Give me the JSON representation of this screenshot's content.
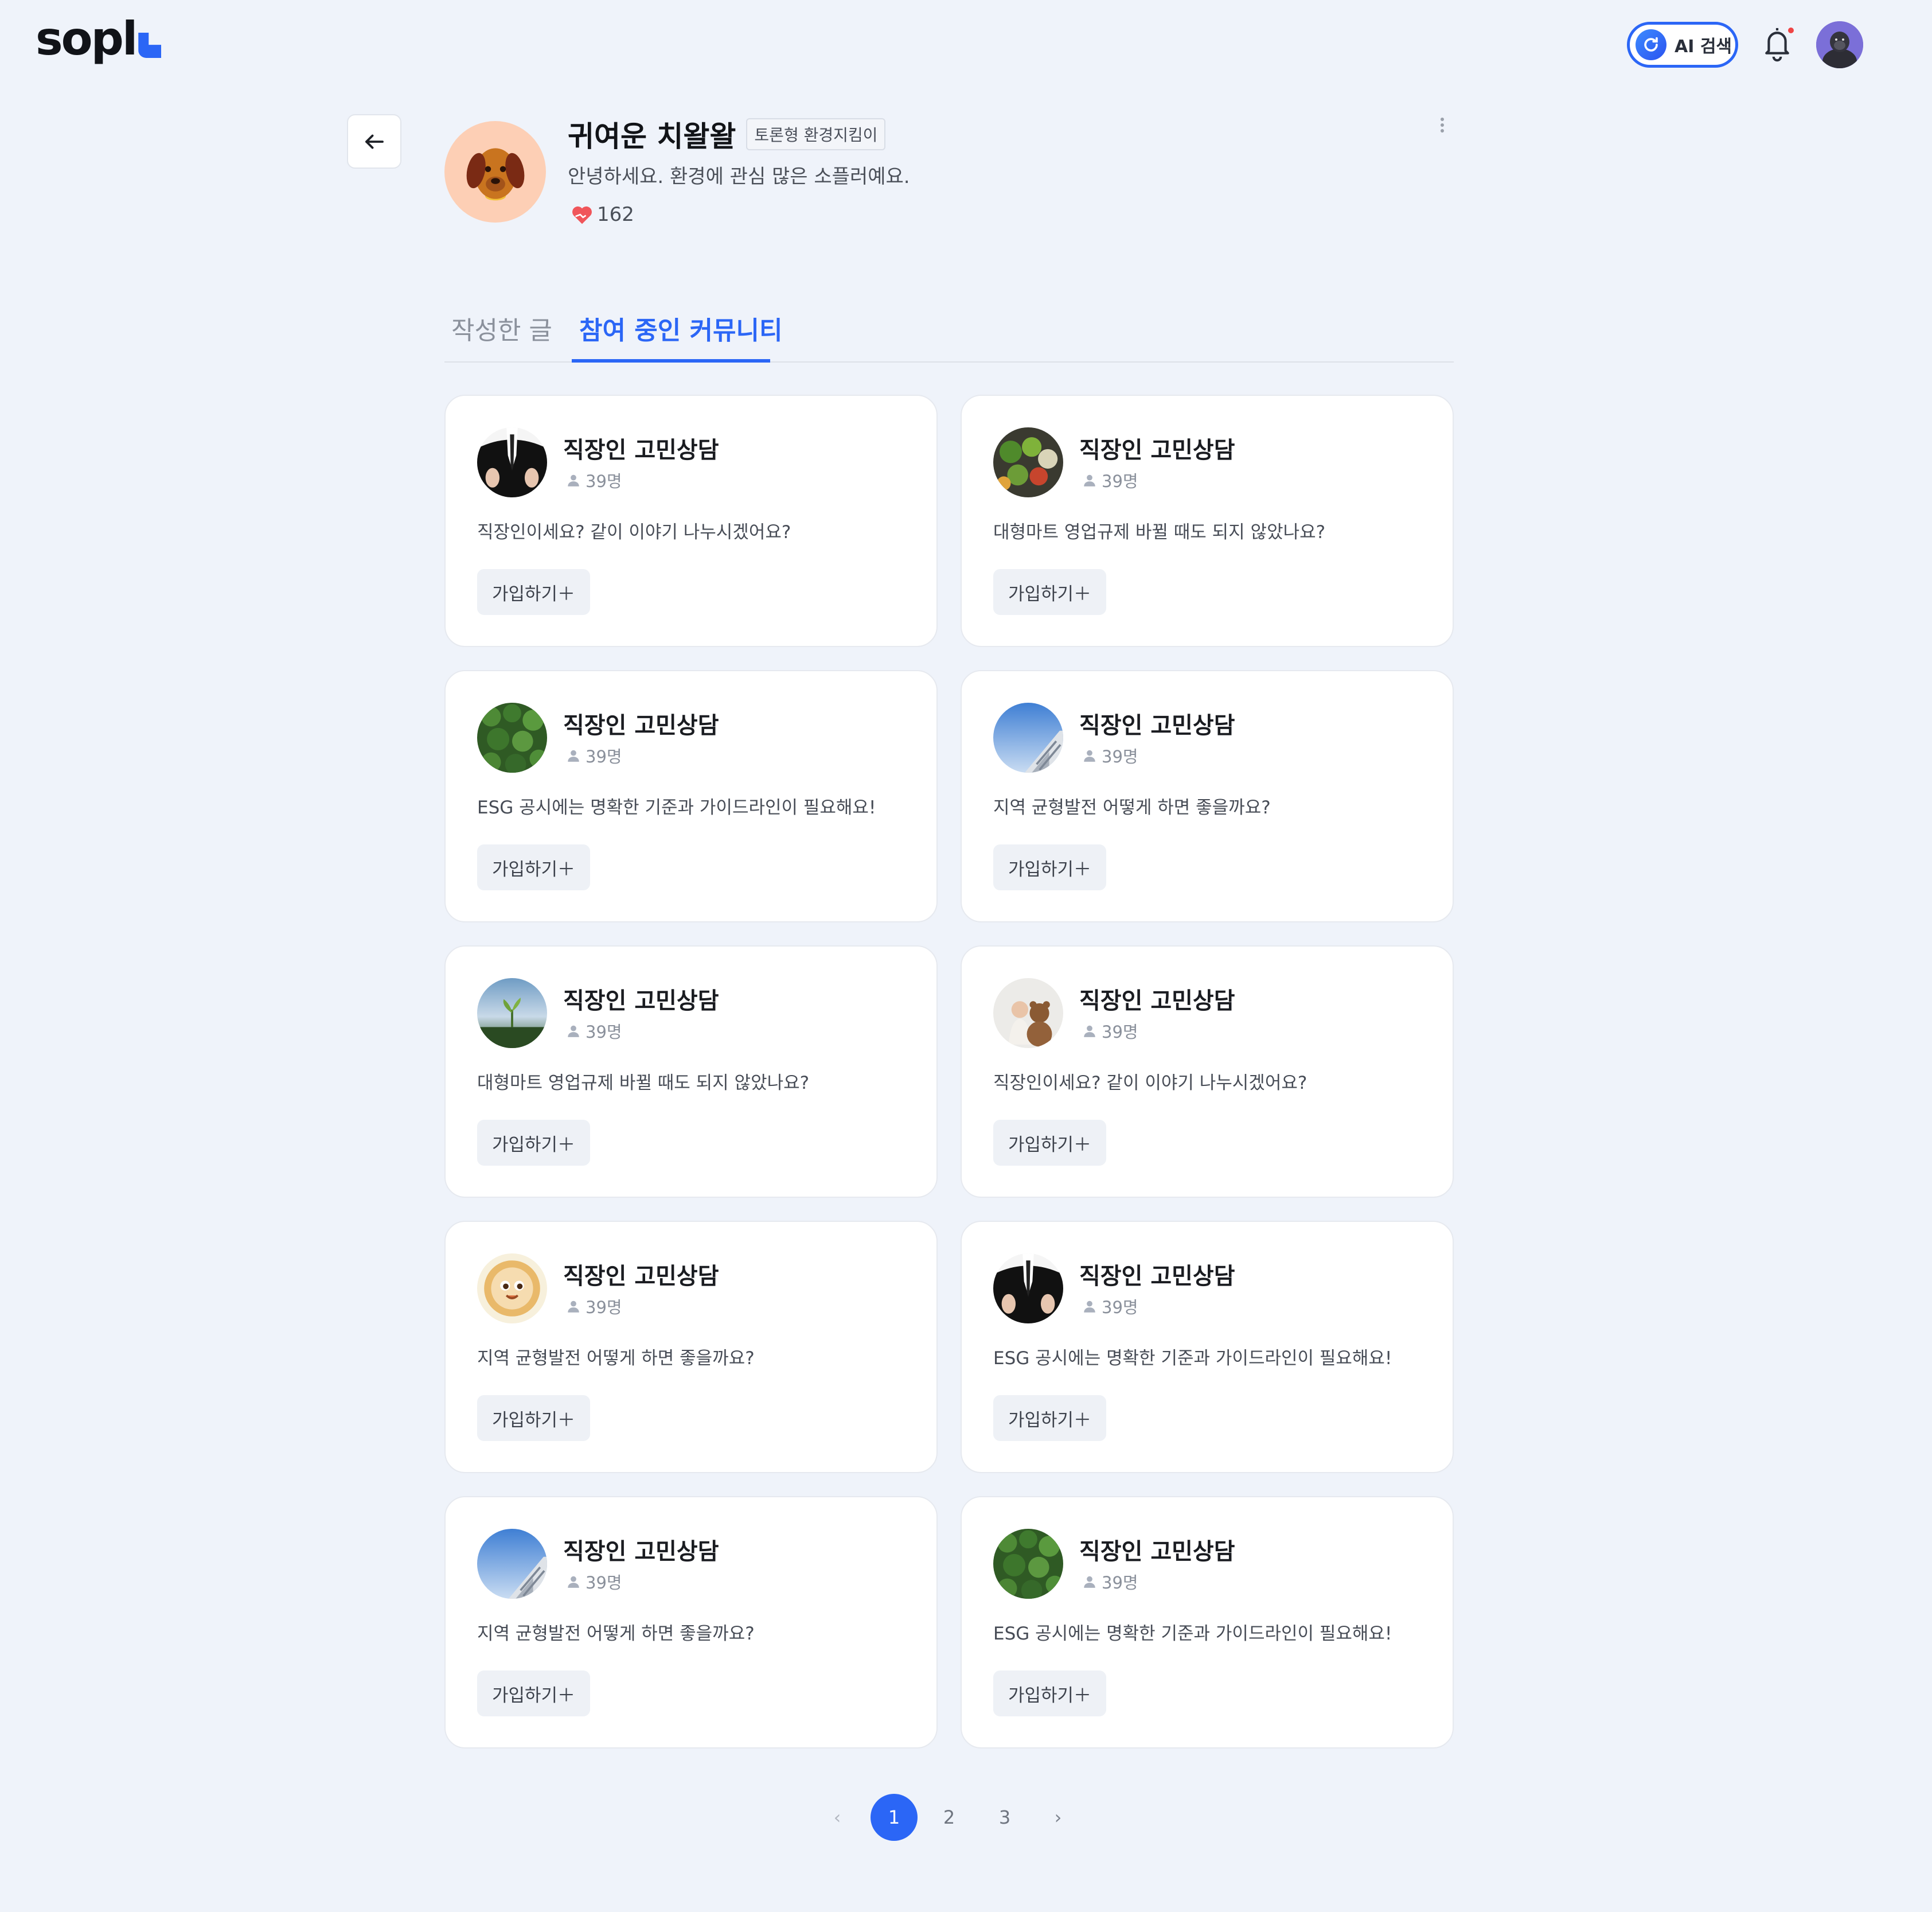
{
  "header": {
    "logo": "sopl",
    "ai_search_label": "AI 검색"
  },
  "profile": {
    "name": "귀여운 치왈왈",
    "badge": "토론형 환경지킴이",
    "bio": "안녕하세요. 환경에 관심 많은 소플러예요.",
    "likes": "162"
  },
  "tabs": {
    "posts": "작성한 글",
    "communities": "참여 중인 커뮤니티",
    "active": "communities"
  },
  "cards": [
    {
      "title": "직장인 고민상담",
      "members": "39명",
      "desc": "직장인이세요? 같이 이야기 나누시겠어요?",
      "join": "가입하기",
      "thumb": "suit"
    },
    {
      "title": "직장인 고민상담",
      "members": "39명",
      "desc": "대형마트 영업규제 바뀔 때도 되지 않았나요?",
      "join": "가입하기",
      "thumb": "vegetables"
    },
    {
      "title": "직장인 고민상담",
      "members": "39명",
      "desc": "ESG 공시에는 명확한 기준과 가이드라인이 필요해요!",
      "join": "가입하기",
      "thumb": "forest"
    },
    {
      "title": "직장인 고민상담",
      "members": "39명",
      "desc": "지역 균형발전 어떻게 하면 좋을까요?",
      "join": "가입하기",
      "thumb": "building"
    },
    {
      "title": "직장인 고민상담",
      "members": "39명",
      "desc": "대형마트 영업규제 바뀔 때도 되지 않았나요?",
      "join": "가입하기",
      "thumb": "sprout"
    },
    {
      "title": "직장인 고민상담",
      "members": "39명",
      "desc": "직장인이세요? 같이 이야기 나누시겠어요?",
      "join": "가입하기",
      "thumb": "baby-bear"
    },
    {
      "title": "직장인 고민상담",
      "members": "39명",
      "desc": "지역 균형발전 어떻게 하면 좋을까요?",
      "join": "가입하기",
      "thumb": "sun-mascot"
    },
    {
      "title": "직장인 고민상담",
      "members": "39명",
      "desc": "ESG 공시에는 명확한 기준과 가이드라인이 필요해요!",
      "join": "가입하기",
      "thumb": "suit"
    },
    {
      "title": "직장인 고민상담",
      "members": "39명",
      "desc": "지역 균형발전 어떻게 하면 좋을까요?",
      "join": "가입하기",
      "thumb": "building"
    },
    {
      "title": "직장인 고민상담",
      "members": "39명",
      "desc": "ESG 공시에는 명확한 기준과 가이드라인이 필요해요!",
      "join": "가입하기",
      "thumb": "forest"
    }
  ],
  "pagination": {
    "pages": [
      "1",
      "2",
      "3"
    ],
    "current": "1"
  },
  "colors": {
    "accent": "#2b66f6",
    "background": "#eff3fa",
    "card": "#ffffff",
    "notification_dot": "#ef4444",
    "heart": "#f0555a"
  }
}
